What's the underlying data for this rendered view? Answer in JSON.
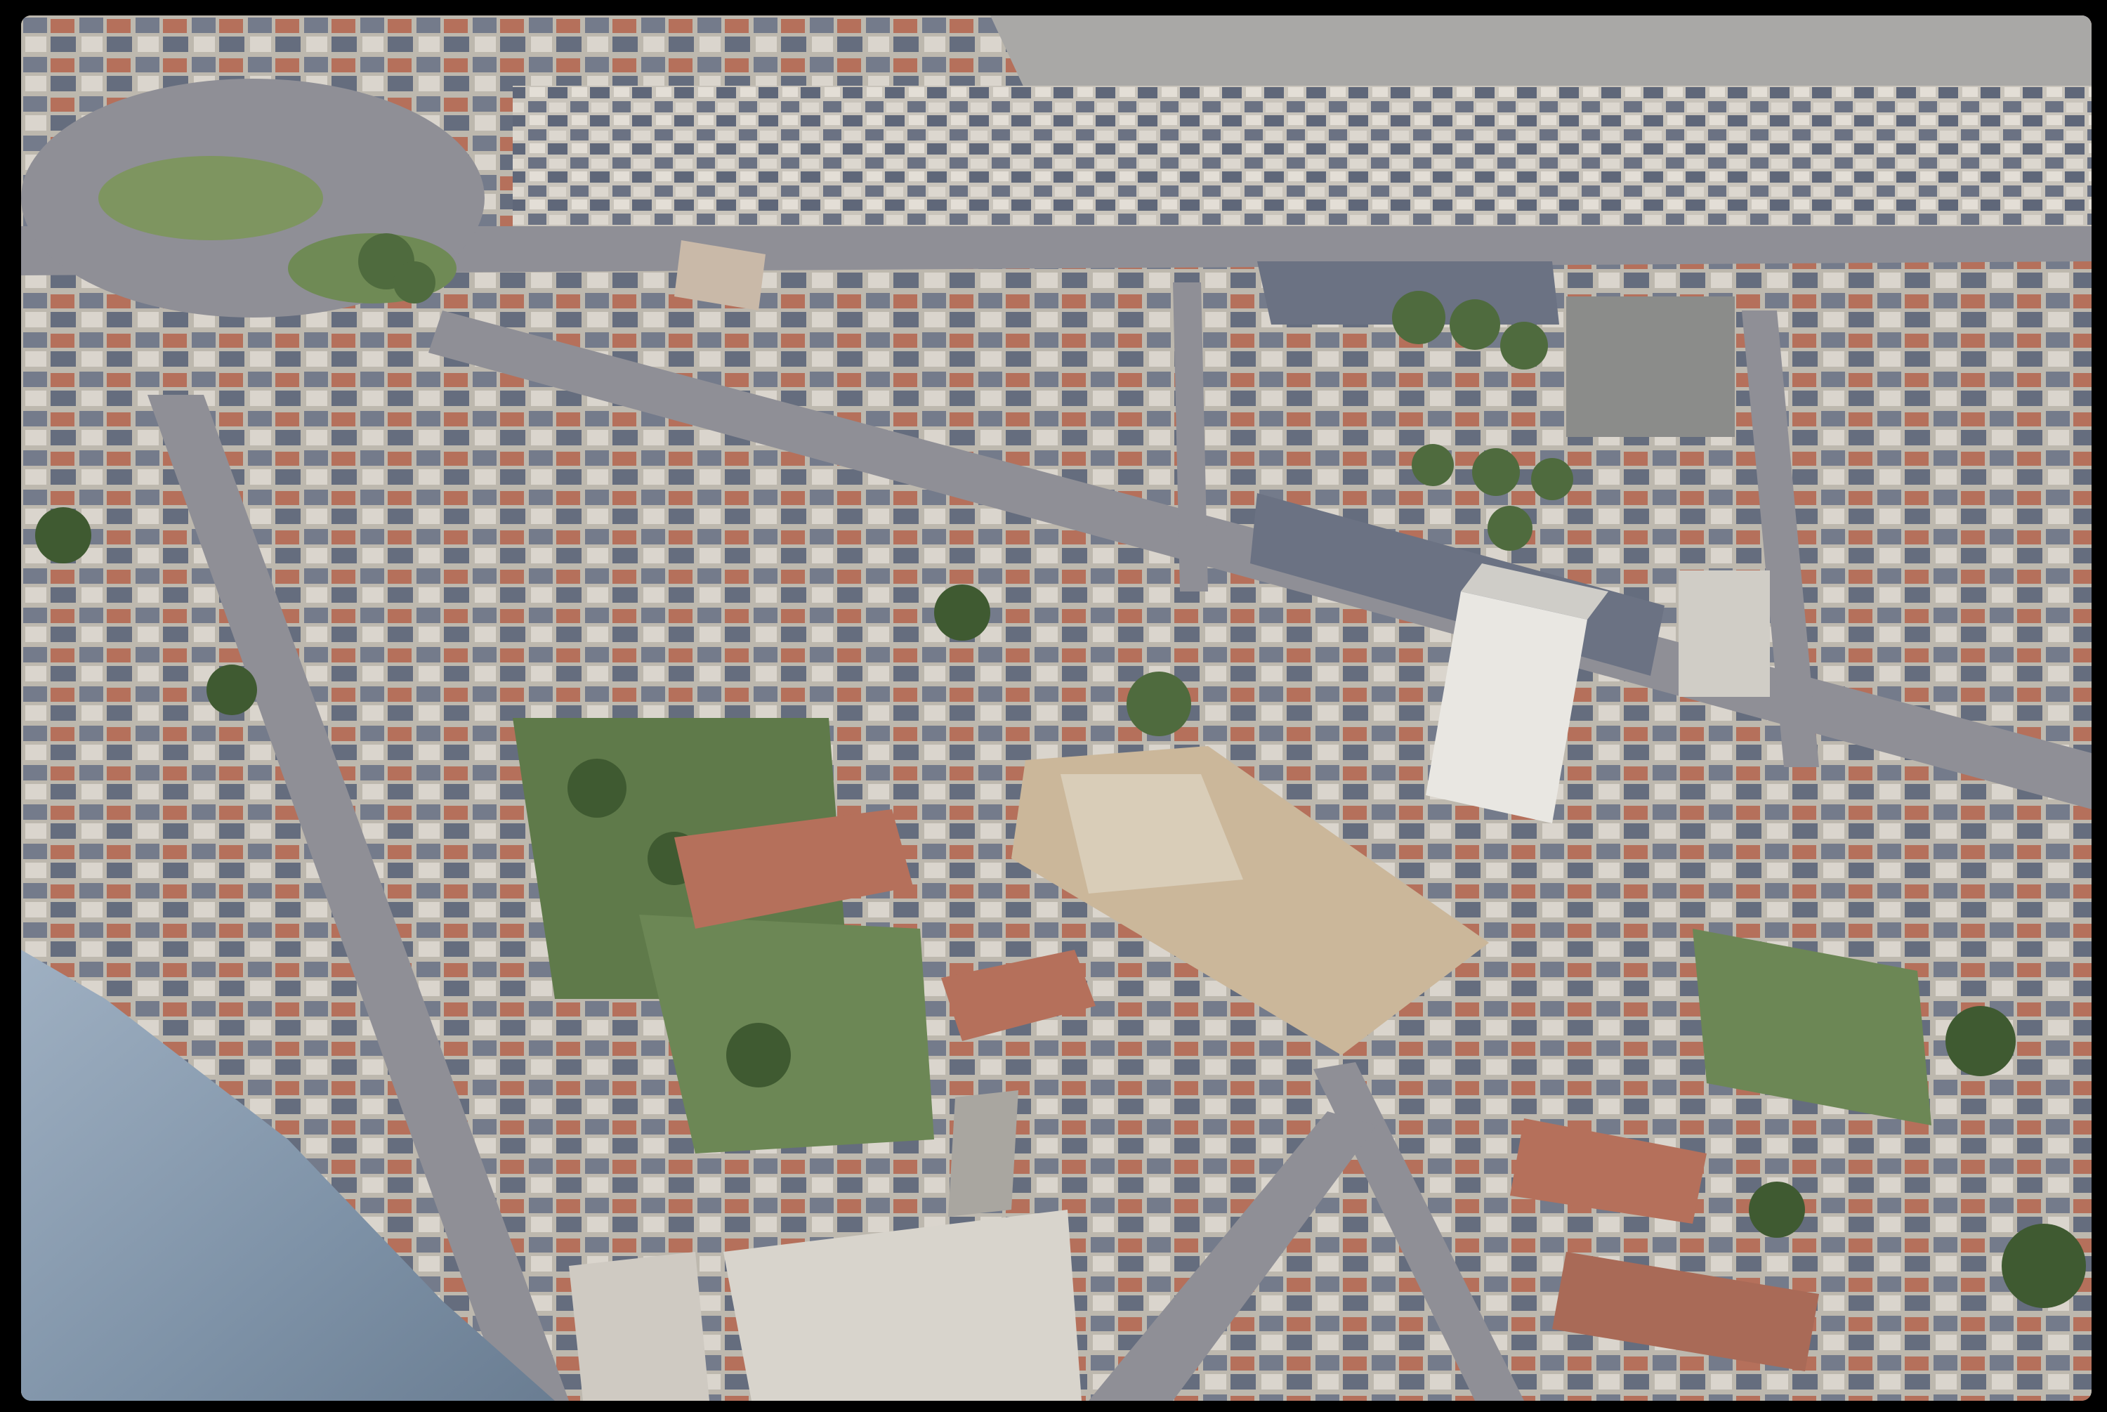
{
  "photo": {
    "scene": "aerial-city-view",
    "palette": {
      "frame": "#000000",
      "road": "#8f8f96",
      "roof_slate": "#6b7283",
      "roof_tile": "#b5705b",
      "wall": "#d8d4cc",
      "vegetation": "#4f6b3e",
      "lawn": "#7e9560",
      "bare_ground": "#cbb79a",
      "wing": "#7d91a6"
    }
  }
}
